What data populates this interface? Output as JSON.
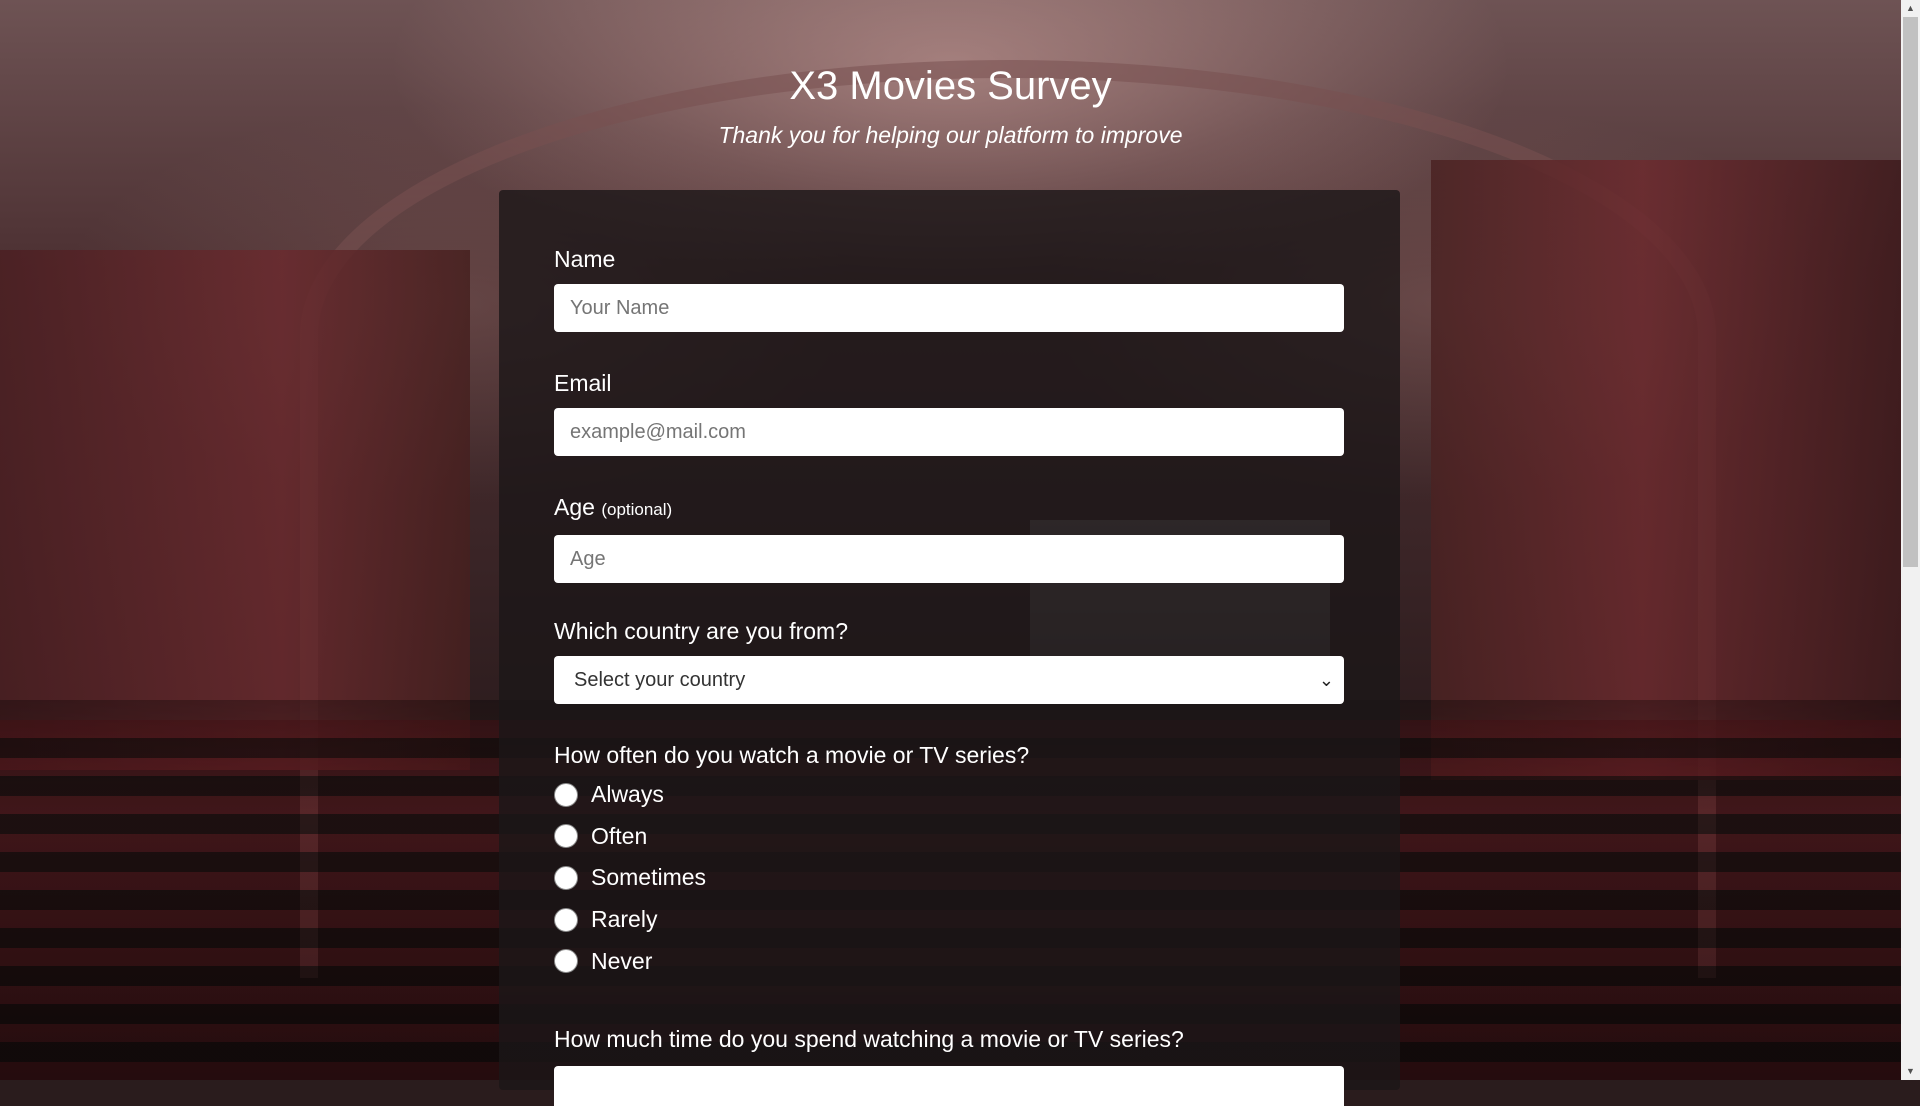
{
  "header": {
    "title": "X3 Movies Survey",
    "subtitle": "Thank you for helping our platform to improve"
  },
  "form": {
    "name": {
      "label": "Name",
      "placeholder": "Your Name"
    },
    "email": {
      "label": "Email",
      "placeholder": "example@mail.com"
    },
    "age": {
      "label": "Age",
      "optional": "(optional)",
      "placeholder": "Age"
    },
    "country": {
      "label": "Which country are you from?",
      "selected": "Select your country"
    },
    "frequency": {
      "label": "How often do you watch a movie or TV series?",
      "options": [
        "Always",
        "Often",
        "Sometimes",
        "Rarely",
        "Never"
      ]
    },
    "time": {
      "label": "How much time do you spend watching a movie or TV series?"
    }
  },
  "icons": {
    "select_chevron": "chevron-down-icon"
  }
}
